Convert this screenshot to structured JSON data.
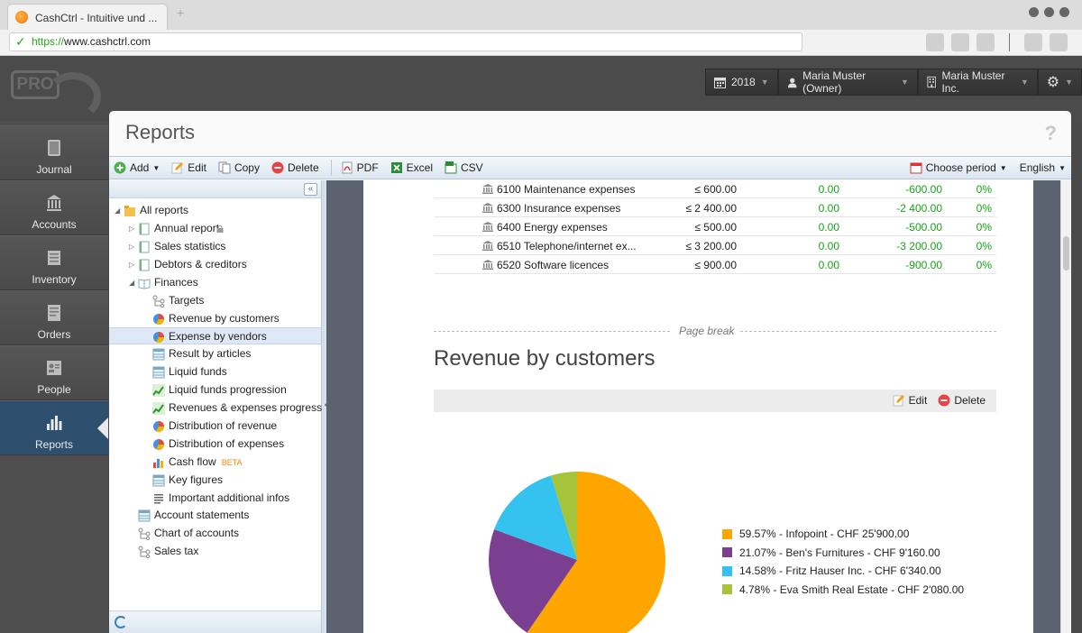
{
  "browser": {
    "tab_title": "CashCtrl - Intuitive und ...",
    "url_proto": "https://",
    "url_host": "www.cashctrl.com"
  },
  "header": {
    "logo_text": "PRO",
    "year": "2018",
    "user": "Maria Muster (Owner)",
    "company": "Maria Muster Inc."
  },
  "sidenav": {
    "items": [
      {
        "label": "Journal",
        "icon": "journal-icon"
      },
      {
        "label": "Accounts",
        "icon": "bank-icon"
      },
      {
        "label": "Inventory",
        "icon": "inventory-icon"
      },
      {
        "label": "Orders",
        "icon": "orders-icon"
      },
      {
        "label": "People",
        "icon": "people-icon"
      },
      {
        "label": "Reports",
        "icon": "bar-chart-icon"
      }
    ],
    "active": "Reports"
  },
  "window": {
    "title": "Reports",
    "help": "?"
  },
  "toolbar": {
    "add": "Add",
    "edit": "Edit",
    "copy": "Copy",
    "delete": "Delete",
    "pdf": "PDF",
    "excel": "Excel",
    "csv": "CSV",
    "period": "Choose period",
    "language": "English"
  },
  "tree": {
    "collapse": "«",
    "items": [
      {
        "label": "All reports"
      },
      {
        "label": "Annual report"
      },
      {
        "label": "Sales statistics"
      },
      {
        "label": "Debtors & creditors"
      },
      {
        "label": "Finances"
      },
      {
        "label": "Targets"
      },
      {
        "label": "Revenue by customers"
      },
      {
        "label": "Expense by vendors"
      },
      {
        "label": "Result by articles"
      },
      {
        "label": "Liquid funds"
      },
      {
        "label": "Liquid funds progression"
      },
      {
        "label": "Revenues & expenses progression"
      },
      {
        "label": "Distribution of revenue"
      },
      {
        "label": "Distribution of expenses"
      },
      {
        "label": "Cash flow"
      },
      {
        "label": "Key figures"
      },
      {
        "label": "Important additional infos"
      },
      {
        "label": "Account statements"
      },
      {
        "label": "Chart of accounts"
      },
      {
        "label": "Sales tax"
      }
    ],
    "beta": "BETA"
  },
  "report": {
    "rows": [
      {
        "name": "6100 Maintenance expenses",
        "budget": "≤ 600.00",
        "actual": "0.00",
        "diff": "-600.00",
        "pct": "0%"
      },
      {
        "name": "6300 Insurance expenses",
        "budget": "≤ 2 400.00",
        "actual": "0.00",
        "diff": "-2 400.00",
        "pct": "0%"
      },
      {
        "name": "6400 Energy expenses",
        "budget": "≤ 500.00",
        "actual": "0.00",
        "diff": "-500.00",
        "pct": "0%"
      },
      {
        "name": "6510 Telephone/internet ex...",
        "budget": "≤ 3 200.00",
        "actual": "0.00",
        "diff": "-3 200.00",
        "pct": "0%"
      },
      {
        "name": "6520 Software licences",
        "budget": "≤ 900.00",
        "actual": "0.00",
        "diff": "-900.00",
        "pct": "0%"
      }
    ],
    "page_break": "Page break",
    "section_title": "Revenue by customers",
    "section_edit": "Edit",
    "section_delete": "Delete"
  },
  "chart_data": {
    "type": "pie",
    "categories": [
      "Infopoint",
      "Ben's Furnitures",
      "Fritz Hauser Inc.",
      "Eva Smith Real Estate"
    ],
    "values": [
      59.57,
      21.07,
      14.58,
      4.78
    ],
    "colors": [
      "#ffa500",
      "#7b3f91",
      "#36c2ef",
      "#a6c43a"
    ],
    "legend": [
      "59.57% - Infopoint - CHF 25'900.00",
      "21.07% - Ben's Furnitures - CHF 9'160.00",
      "14.58% - Fritz Hauser Inc. - CHF 6'340.00",
      "4.78% - Eva Smith Real Estate - CHF 2'080.00"
    ],
    "legend_position": "right"
  }
}
